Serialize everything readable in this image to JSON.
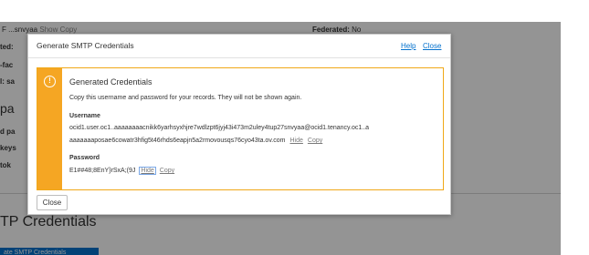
{
  "background": {
    "top_left_snippet": "F ...snvyaa",
    "top_left_show": "Show",
    "top_left_copy": "Copy",
    "federated_label": "Federated:",
    "federated_value": "No",
    "side_labels": [
      "ted:",
      "-fac",
      "l: sa",
      "pa",
      "d pa",
      "keys",
      "tok"
    ],
    "section_heading": "TP Credentials",
    "action_button": "ate SMTP Credentials"
  },
  "dialog": {
    "title": "Generate SMTP Credentials",
    "help": "Help",
    "close_link": "Close",
    "alert": {
      "icon": "warning-circle-icon",
      "title": "Generated Credentials",
      "description": "Copy this username and password for your records. They will not be shown again.",
      "username_label": "Username",
      "username_line1": "ocid1.user.oc1..aaaaaaaacnikk6yarhsyxhjre7wdlzpt6jyj43i473m2uley4tup27snvyaa@ocid1.tenancy.oc1..a",
      "username_line2": "aaaaaaaposae6cowatr3hfig5t46rhds6eapjn5a2rmovousqs76cyo43ta.ov.com",
      "username_hide": "Hide",
      "username_copy": "Copy",
      "password_label": "Password",
      "password_value": "E1##48;8EnY}rSxA;(9J",
      "password_hide": "Hide",
      "password_copy": "Copy"
    },
    "close_button": "Close"
  },
  "colors": {
    "accent": "#0572ce",
    "warning": "#f5a623",
    "overlay": "rgba(0,0,0,0.42)"
  }
}
